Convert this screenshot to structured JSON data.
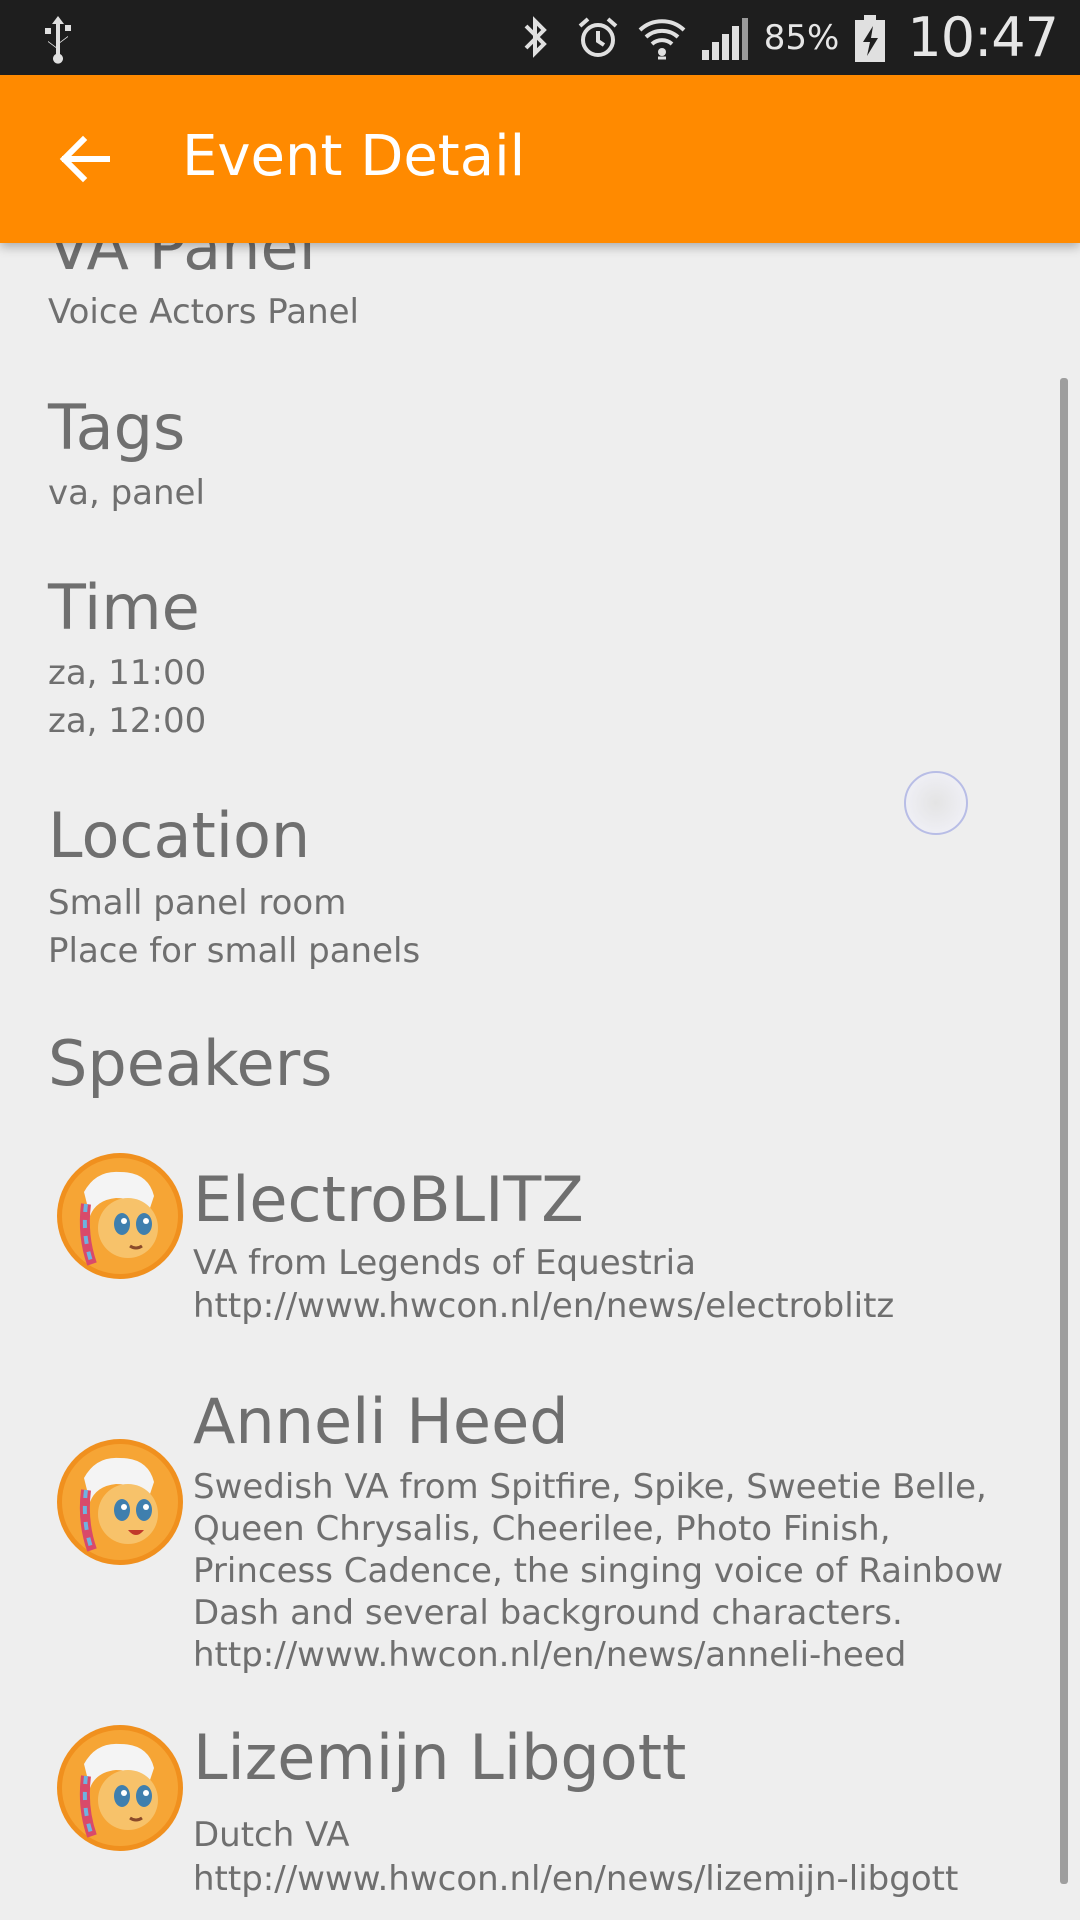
{
  "status_bar": {
    "battery_percent": "85%",
    "time": "10:47",
    "icons": [
      "usb-icon",
      "bluetooth-icon",
      "alarm-icon",
      "wifi-icon",
      "signal-icon",
      "battery-charging-icon"
    ]
  },
  "app_bar": {
    "title": "Event Detail",
    "back_icon": "arrow-back-icon",
    "color": "#ff8a00"
  },
  "event": {
    "title": "VA Panel",
    "subtitle": "Voice Actors Panel"
  },
  "tags": {
    "heading": "Tags",
    "value": "va, panel"
  },
  "time": {
    "heading": "Time",
    "start": "za, 11:00",
    "end": "za, 12:00"
  },
  "location": {
    "heading": "Location",
    "name": "Small panel room",
    "description": "Place for small panels"
  },
  "speakers": {
    "heading": "Speakers",
    "items": [
      {
        "name": "ElectroBLITZ",
        "description": "VA from Legends of Equestria",
        "url": "http://www.hwcon.nl/en/news/electroblitz"
      },
      {
        "name": "Anneli Heed",
        "description": "Swedish VA from Spitfire, Spike, Sweetie Belle, Queen Chrysalis, Cheerilee, Photo Finish, Princess Cadence, the singing voice of Rainbow Dash and several background characters.",
        "url": "http://www.hwcon.nl/en/news/anneli-heed"
      },
      {
        "name": "Lizemijn Libgott",
        "description": "Dutch VA",
        "url": "http://www.hwcon.nl/en/news/lizemijn-libgott"
      }
    ]
  }
}
